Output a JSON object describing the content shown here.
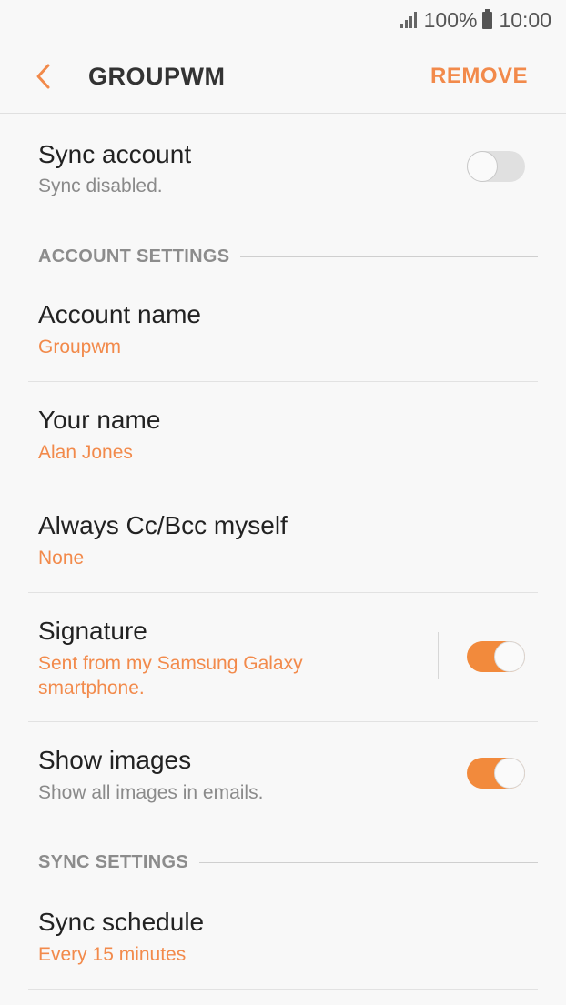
{
  "status_bar": {
    "battery": "100%",
    "time": "10:00"
  },
  "app_bar": {
    "title": "GROUPWM",
    "remove_label": "REMOVE"
  },
  "sync_account": {
    "title": "Sync account",
    "subtitle": "Sync disabled.",
    "enabled": false
  },
  "account_settings": {
    "header": "ACCOUNT SETTINGS",
    "account_name": {
      "title": "Account name",
      "value": "Groupwm"
    },
    "your_name": {
      "title": "Your name",
      "value": "Alan Jones"
    },
    "always_cc": {
      "title": "Always Cc/Bcc myself",
      "value": "None"
    },
    "signature": {
      "title": "Signature",
      "value_line1": "Sent from my Samsung Galaxy",
      "value_line2": "smartphone.",
      "enabled": true
    },
    "show_images": {
      "title": "Show images",
      "subtitle": "Show all images in emails.",
      "enabled": true
    }
  },
  "sync_settings": {
    "header": "SYNC SETTINGS",
    "sync_schedule": {
      "title": "Sync schedule",
      "value": "Every 15 minutes"
    }
  },
  "colors": {
    "accent": "#f28a4b",
    "toggle_on": "#f28a3c",
    "background": "#f8f8f8"
  }
}
